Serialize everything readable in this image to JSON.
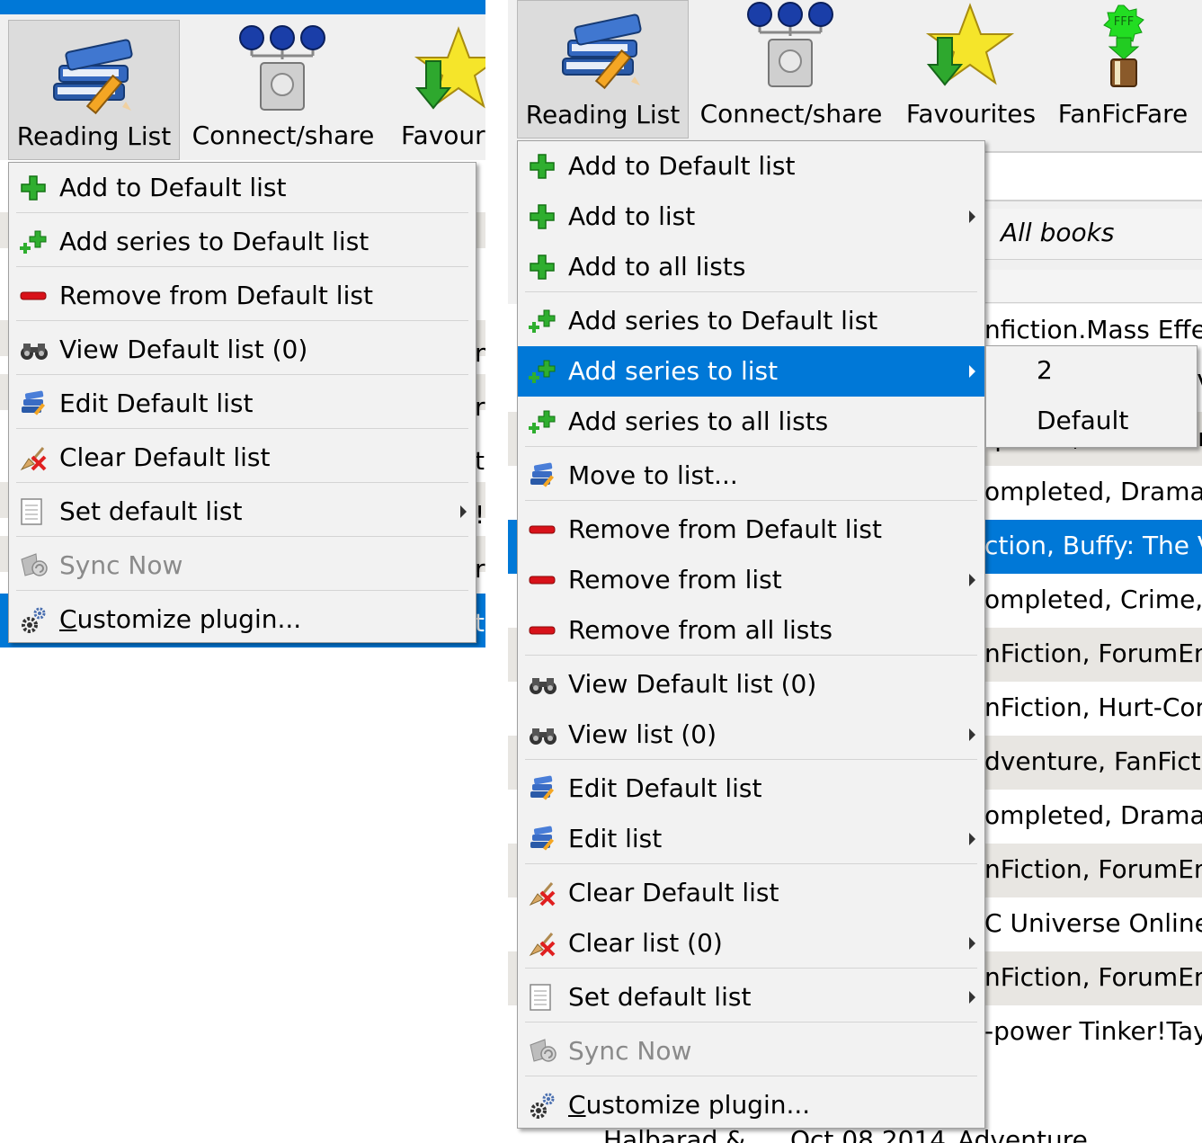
{
  "left": {
    "toolbar": {
      "reading_list": "Reading List",
      "connect_share": "Connect/share",
      "favourites": "Favouri"
    },
    "bg_letters": [
      "n",
      "r",
      "t",
      "!",
      "r",
      "t"
    ],
    "menu": [
      {
        "label": "Add to Default list",
        "icon": "plus-icon"
      },
      {
        "label": "Add series to Default list",
        "icon": "plus-small-icon"
      },
      {
        "label": "Remove from Default list",
        "icon": "minus-icon"
      },
      {
        "label": "View Default list (0)",
        "icon": "binoculars-icon"
      },
      {
        "label": "Edit Default list",
        "icon": "books-edit-icon"
      },
      {
        "label": "Clear Default list",
        "icon": "clear-icon"
      },
      {
        "label": "Set default list",
        "icon": "document-icon",
        "submenu": true
      },
      {
        "label": "Sync Now",
        "icon": "sync-icon",
        "disabled": true
      },
      {
        "label": "Customize plugin...",
        "icon": "gear-icon"
      }
    ]
  },
  "right": {
    "toolbar": {
      "reading_list": "Reading List",
      "connect_share": "Connect/share",
      "favourites": "Favourites",
      "fanficfare": "FanFicFare",
      "fff_badge": "FFF"
    },
    "all_books": "All books",
    "menu": [
      {
        "label": "Add to Default list",
        "icon": "plus-icon"
      },
      {
        "label": "Add to list",
        "icon": "plus-icon",
        "submenu": true
      },
      {
        "label": "Add to all lists",
        "icon": "plus-icon"
      },
      {
        "label": "Add series to Default list",
        "icon": "plus-small-icon"
      },
      {
        "label": "Add series to list",
        "icon": "plus-small-icon",
        "submenu": true,
        "highlighted": true
      },
      {
        "label": "Add series to all lists",
        "icon": "plus-small-icon"
      },
      {
        "label": "Move to list...",
        "icon": "books-edit-icon"
      },
      {
        "label": "Remove from Default list",
        "icon": "minus-icon"
      },
      {
        "label": "Remove from list",
        "icon": "minus-icon",
        "submenu": true
      },
      {
        "label": "Remove from all lists",
        "icon": "minus-icon"
      },
      {
        "label": "View Default list (0)",
        "icon": "binoculars-icon"
      },
      {
        "label": "View list (0)",
        "icon": "binoculars-icon",
        "submenu": true
      },
      {
        "label": "Edit Default list",
        "icon": "books-edit-icon"
      },
      {
        "label": "Edit list",
        "icon": "books-edit-icon",
        "submenu": true
      },
      {
        "label": "Clear Default list",
        "icon": "clear-icon"
      },
      {
        "label": "Clear list (0)",
        "icon": "clear-icon",
        "submenu": true
      },
      {
        "label": "Set default list",
        "icon": "document-icon",
        "submenu": true
      },
      {
        "label": "Sync Now",
        "icon": "sync-icon",
        "disabled": true
      },
      {
        "label": "Customize plugin...",
        "icon": "gear-icon"
      }
    ],
    "submenu": [
      "2",
      "Default"
    ],
    "library_rows": [
      "nfiction.Mass Effec",
      "ction, Buffy: The Va",
      "!power, FanFiction",
      "ompleted, Drama, F",
      "ction, Buffy: The Va",
      "ompleted, Crime, D",
      "nFiction, ForumEm",
      "nFiction, Hurt-Com",
      "dventure, FanFictio",
      "ompleted, Drama, F",
      "nFiction, ForumEm",
      "C Universe Online,",
      "nFiction, ForumEm",
      "-power Tinker!Tayl"
    ],
    "bottom_row": {
      "author": "Halbarad &",
      "date": "Oct 08 2014",
      "tags": "Adventure, Complete"
    }
  }
}
